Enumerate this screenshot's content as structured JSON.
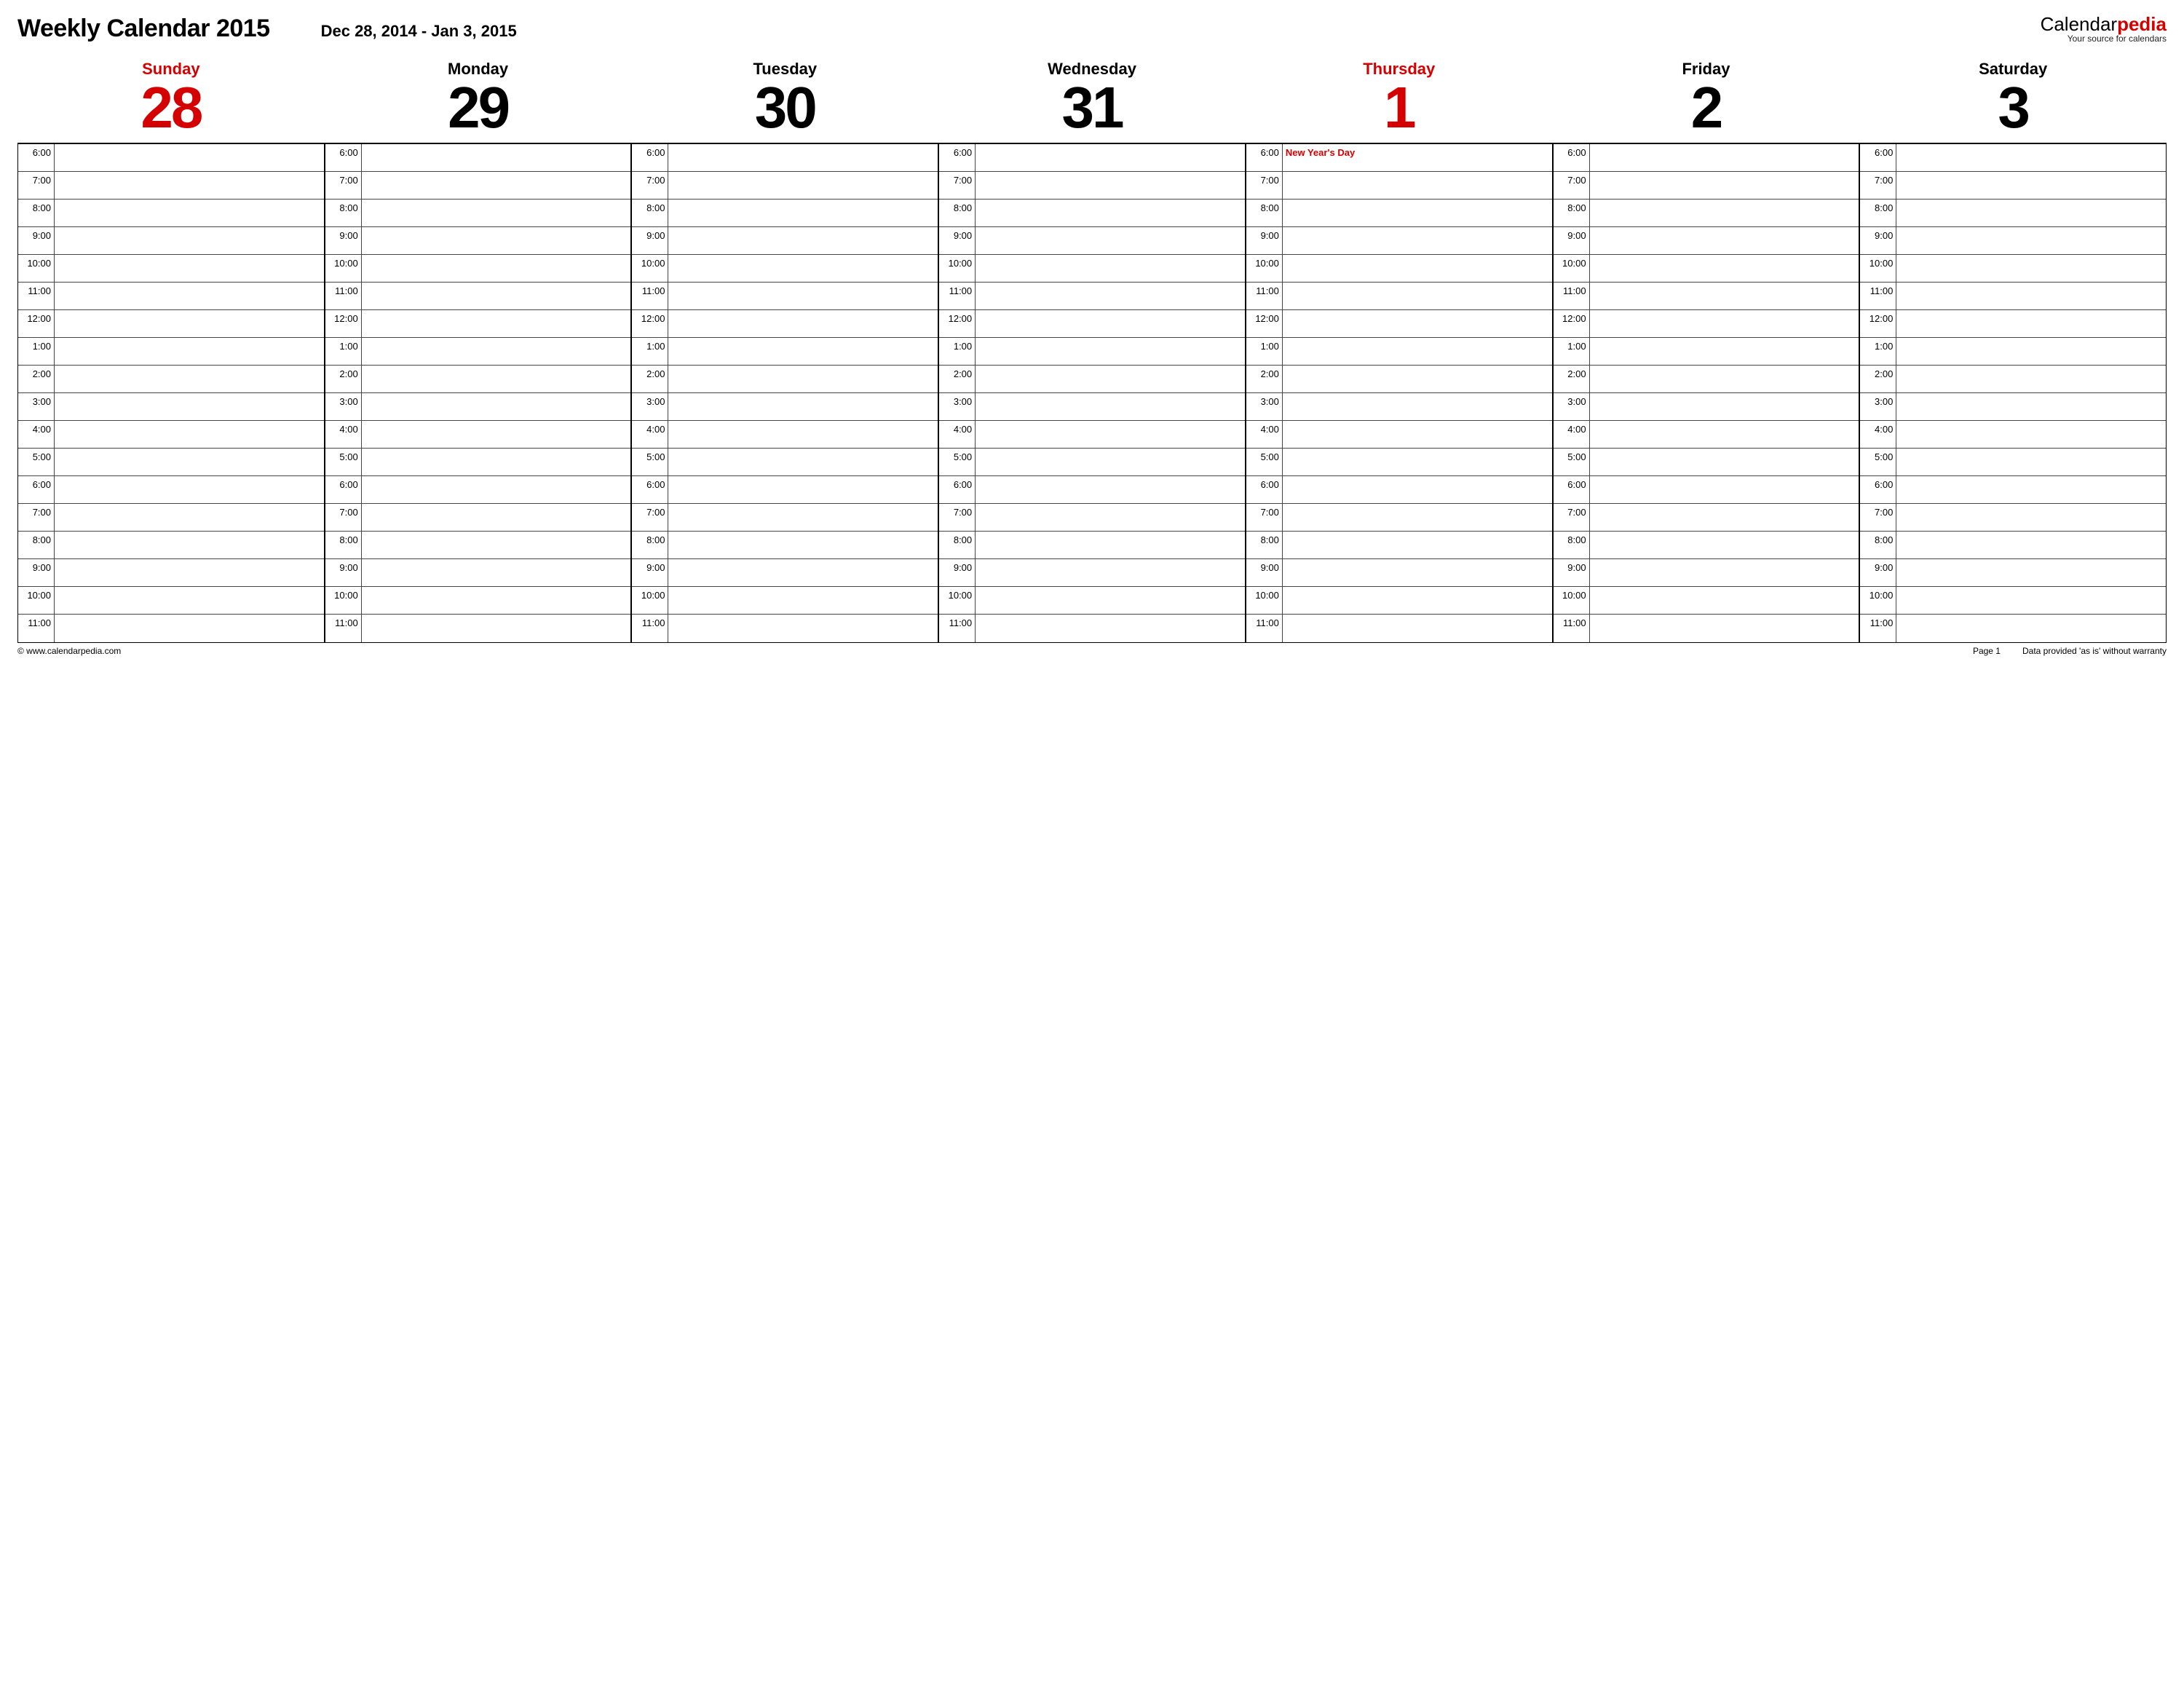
{
  "header": {
    "title": "Weekly Calendar 2015",
    "date_range": "Dec 28, 2014 - Jan 3, 2015",
    "brand_prefix": "Calendar",
    "brand_suffix": "pedia",
    "brand_tag": "Your source for calendars"
  },
  "days": [
    {
      "name": "Sunday",
      "num": "28",
      "highlight": true
    },
    {
      "name": "Monday",
      "num": "29",
      "highlight": false
    },
    {
      "name": "Tuesday",
      "num": "30",
      "highlight": false
    },
    {
      "name": "Wednesday",
      "num": "31",
      "highlight": false
    },
    {
      "name": "Thursday",
      "num": "1",
      "highlight": true
    },
    {
      "name": "Friday",
      "num": "2",
      "highlight": false
    },
    {
      "name": "Saturday",
      "num": "3",
      "highlight": false
    }
  ],
  "times": [
    "6:00",
    "7:00",
    "8:00",
    "9:00",
    "10:00",
    "11:00",
    "12:00",
    "1:00",
    "2:00",
    "3:00",
    "4:00",
    "5:00",
    "6:00",
    "7:00",
    "8:00",
    "9:00",
    "10:00",
    "11:00"
  ],
  "events": {
    "4": {
      "0": "New Year's Day"
    }
  },
  "footer": {
    "copyright": "© www.calendarpedia.com",
    "page": "Page 1",
    "disclaimer": "Data provided 'as is' without warranty"
  }
}
